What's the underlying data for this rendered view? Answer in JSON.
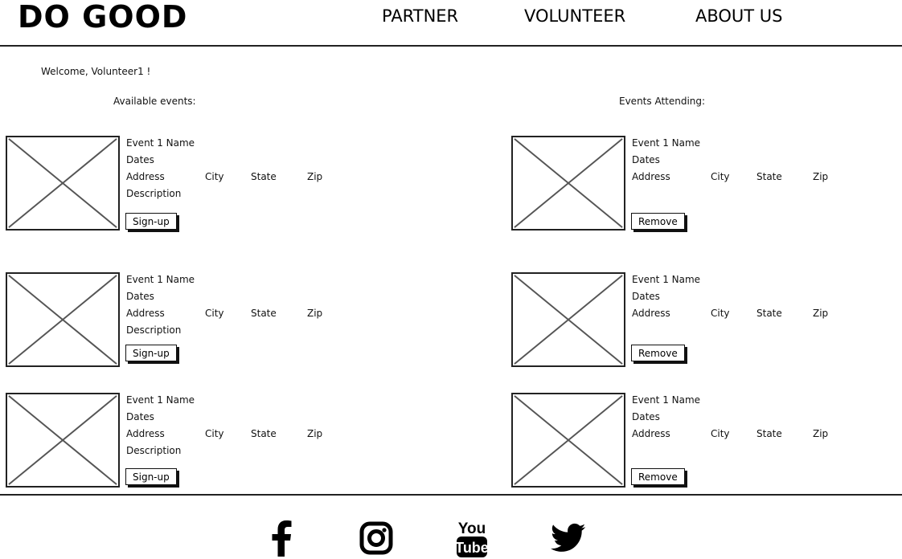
{
  "header": {
    "brand": "DO GOOD",
    "nav": [
      {
        "label": "PARTNER"
      },
      {
        "label": "VOLUNTEER"
      },
      {
        "label": "ABOUT US"
      }
    ]
  },
  "welcome": "Welcome, Volunteer1 !",
  "available": {
    "title": "Available events:",
    "events": [
      {
        "name": "Event 1 Name",
        "dates": "Dates",
        "address": "Address",
        "city": "City",
        "state": "State",
        "zip": "Zip",
        "description": "Description",
        "button": "Sign-up"
      },
      {
        "name": "Event 1 Name",
        "dates": "Dates",
        "address": "Address",
        "city": "City",
        "state": "State",
        "zip": "Zip",
        "description": "Description",
        "button": "Sign-up"
      },
      {
        "name": "Event 1 Name",
        "dates": "Dates",
        "address": "Address",
        "city": "City",
        "state": "State",
        "zip": "Zip",
        "description": "Description",
        "button": "Sign-up"
      }
    ]
  },
  "attending": {
    "title": "Events Attending:",
    "events": [
      {
        "name": "Event 1 Name",
        "dates": "Dates",
        "address": "Address",
        "city": "City",
        "state": "State",
        "zip": "Zip",
        "button": "Remove"
      },
      {
        "name": "Event 1 Name",
        "dates": "Dates",
        "address": "Address",
        "city": "City",
        "state": "State",
        "zip": "Zip",
        "button": "Remove"
      },
      {
        "name": "Event 1 Name",
        "dates": "Dates",
        "address": "Address",
        "city": "City",
        "state": "State",
        "zip": "Zip",
        "button": "Remove"
      }
    ]
  },
  "footer": {
    "social_icons": [
      "facebook-icon",
      "instagram-icon",
      "youtube-icon",
      "twitter-icon"
    ],
    "youtube_text_top": "You",
    "youtube_text_bottom": "Tube"
  }
}
